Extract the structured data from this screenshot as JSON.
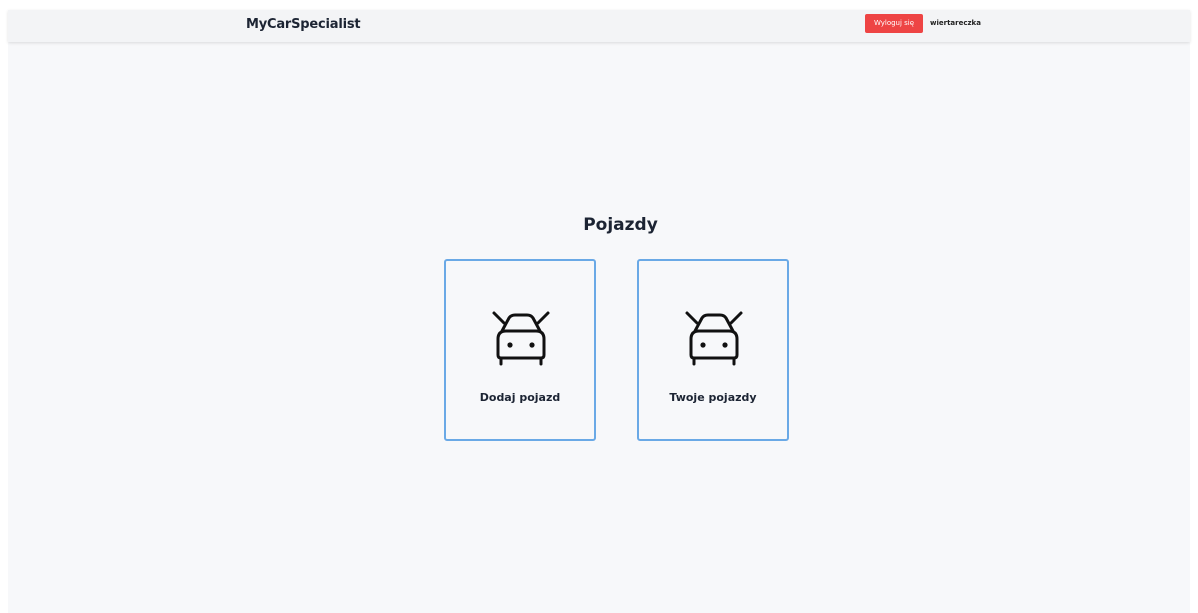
{
  "navbar": {
    "brand": "MyCarSpecialist",
    "logout_label": "Wyloguj się",
    "username": "wiertareczka",
    "logout_color": "#ee4444"
  },
  "main": {
    "title": "Pojazdy",
    "cards": [
      {
        "label": "Dodaj pojazd",
        "icon": "car-icon"
      },
      {
        "label": "Twoje pojazdy",
        "icon": "car-icon"
      }
    ],
    "card_border_color": "#6aa9e6"
  }
}
